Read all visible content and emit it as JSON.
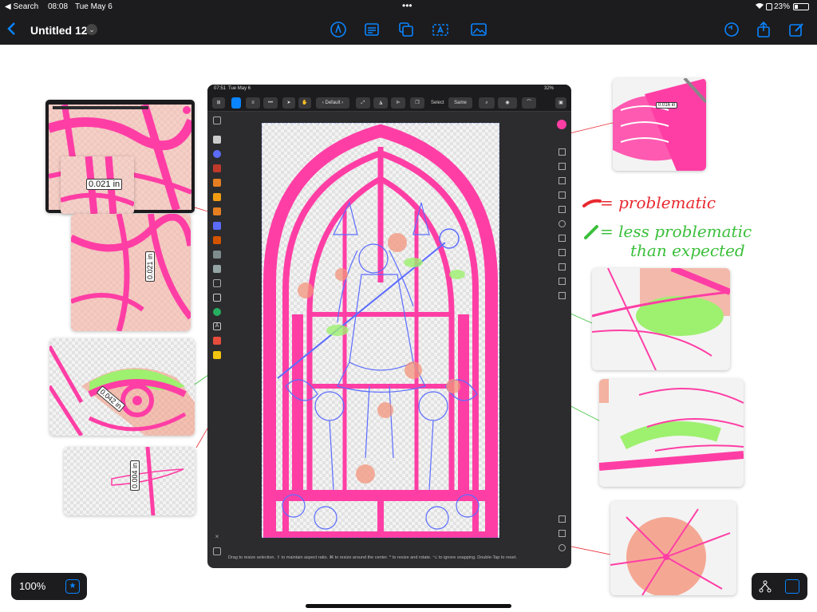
{
  "status_bar": {
    "back_app": "◀ Search",
    "time": "08:08",
    "date": "Tue May 6",
    "more": "•••",
    "battery": "23%"
  },
  "top_bar": {
    "title": "Untitled 12",
    "icons": [
      "back-chevron-icon",
      "pen-icon",
      "document-icon",
      "copy-icon",
      "text-frame-icon",
      "image-icon",
      "undo-icon",
      "share-icon",
      "edit-icon"
    ]
  },
  "inner_screenshot": {
    "status_time": "07:51",
    "status_date": "Tue May 6",
    "status_battery": "32%",
    "preset": "Default",
    "select_label": "Select",
    "same_label": "Same",
    "hint": "Drag to resize selection. ⇧ to maintain aspect ratio. ⌘ to resize around the center. ^ to resize and rotate. ⌥ to ignore snapping. Double-Tap to reset.",
    "accent_color": "#ff3ea5"
  },
  "measurements": {
    "top_left_overlay": "0.021 in",
    "left_middle": "0.021 in",
    "eye_card": "0.042 in",
    "bottom_left_card": "0.004 in",
    "top_right_card": "0.016 in"
  },
  "legend": {
    "red_label": "= problematic",
    "green_label_line1": "= less problematic",
    "green_label_line2": "than expected",
    "red_color": "#e8282f",
    "green_color": "#3bbf3b"
  },
  "colors": {
    "magenta": "#ff3ea5",
    "line_blue": "#5b6cff",
    "salmon": "#f4957c",
    "light_green": "#9ef06f",
    "ios_blue": "#0a84ff"
  },
  "bottom": {
    "zoom": "100%"
  }
}
